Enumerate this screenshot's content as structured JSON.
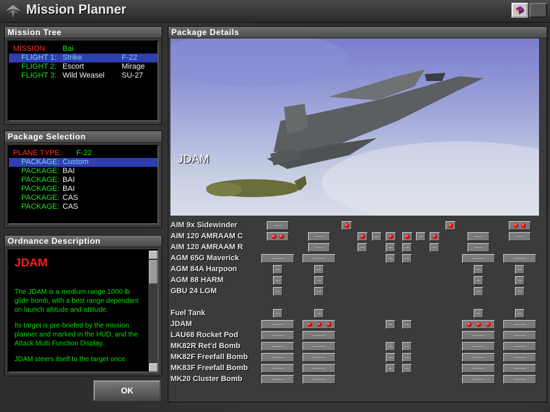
{
  "window": {
    "title": "Mission Planner"
  },
  "mission_tree": {
    "header": "Mission Tree",
    "mission_label": "MISSION:",
    "mission_value": "Bai",
    "flights": [
      {
        "label": "FLIGHT 1:",
        "role": "Strike",
        "aircraft": "F-22",
        "selected": true
      },
      {
        "label": "FLIGHT 2:",
        "role": "Escort",
        "aircraft": "Mirage",
        "selected": false
      },
      {
        "label": "FLIGHT 3:",
        "role": "Wild Weasel",
        "aircraft": "SU-27",
        "selected": false
      }
    ]
  },
  "package_selection": {
    "header": "Package Selection",
    "plane_type_label": "PLANE TYPE:",
    "plane_type_value": "F-22",
    "packages": [
      {
        "label": "PACKAGE:",
        "value": "Custom",
        "selected": true
      },
      {
        "label": "PACKAGE:",
        "value": "BAI",
        "selected": false
      },
      {
        "label": "PACKAGE:",
        "value": "BAI",
        "selected": false
      },
      {
        "label": "PACKAGE:",
        "value": "BAI",
        "selected": false
      },
      {
        "label": "PACKAGE:",
        "value": "CAS",
        "selected": false
      },
      {
        "label": "PACKAGE:",
        "value": "CAS",
        "selected": false
      }
    ]
  },
  "ordnance_description": {
    "header": "Ordnance Description",
    "title": "JDAM",
    "paragraphs": [
      "The JDAM is a medium range 1000 lb glide bomb, with a best range dependant on launch altitude and attitude.",
      "Its target is pre-briefed by the mission planner and marked in the HUD, and the Attack Multi Function Display.",
      "JDAM steers itself to the target once"
    ]
  },
  "ok_button": "OK",
  "package_details": {
    "header": "Package Details",
    "preview_label": "JDAM",
    "ordnance": [
      "AIM 9x Sidewinder",
      "AIM 120 AMRAAM C",
      "AIM 120 AMRAAM R",
      "AGM 65G Maverick",
      "AGM 84A Harpoon",
      "AGM 88 HARM",
      "GBU 24 LGM",
      "Fuel Tank",
      "JDAM",
      "LAU68 Rocket Pod",
      "MK82R Ret'd Bomb",
      "MK82F Freefall Bomb",
      "MK83F Freefall Bomb",
      "MK20 Cluster Bomb"
    ]
  },
  "colors": {
    "highlight": "#2f3fb0",
    "label_red": "#ff2a2a",
    "label_green": "#20e020",
    "led_red": "#e00000"
  }
}
